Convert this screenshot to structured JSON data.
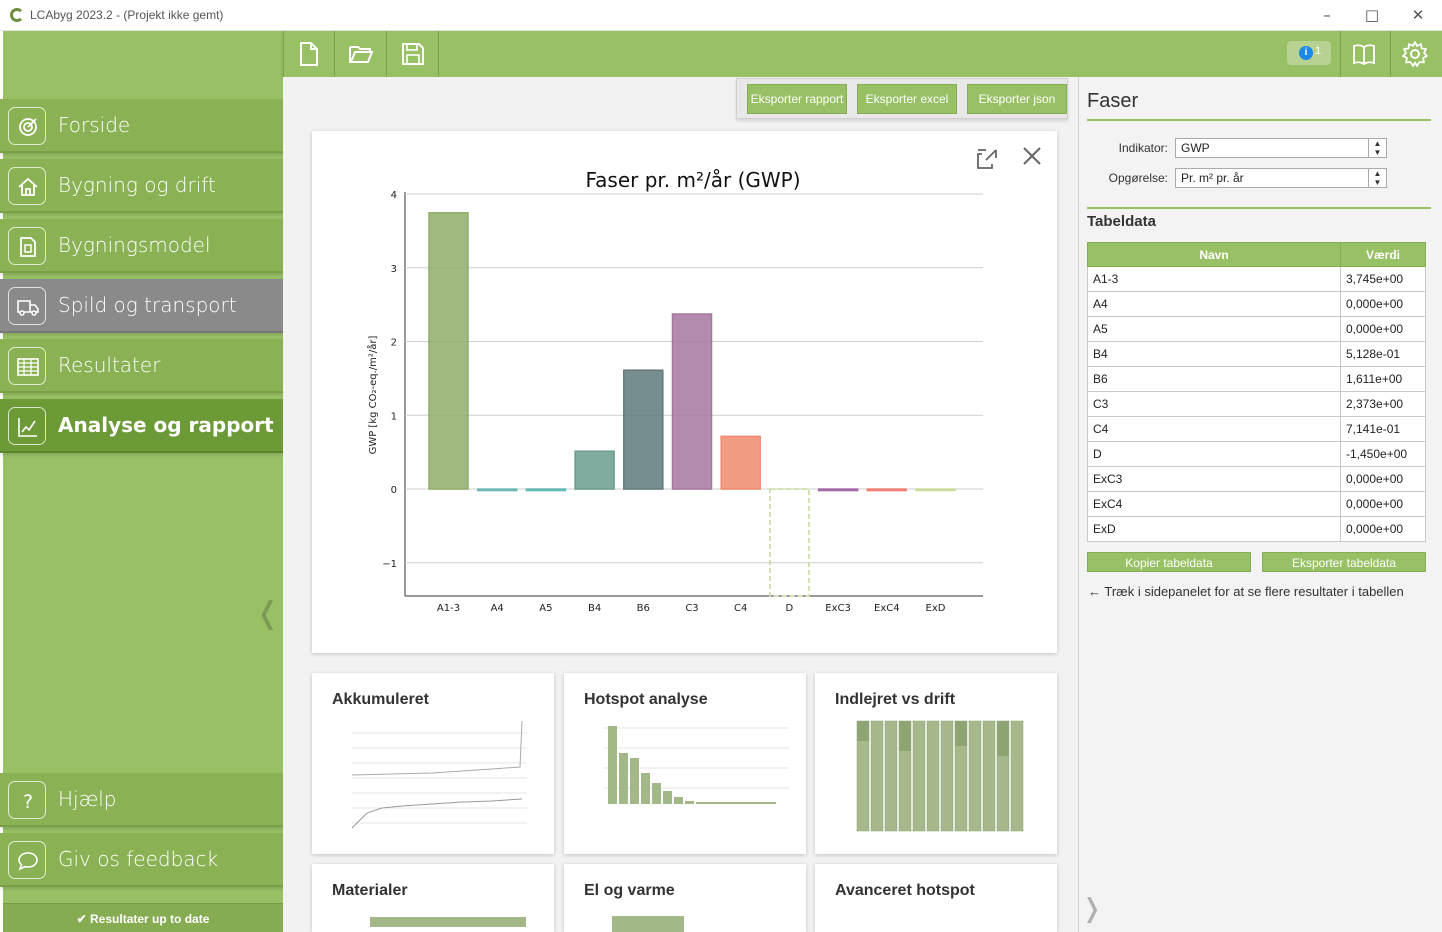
{
  "window": {
    "title": "LCAbyg 2023.2 - (Projekt ikke gemt)",
    "controls": {
      "minimize": "–",
      "maximize": "□",
      "close": "✕"
    }
  },
  "sidebar": {
    "items": [
      {
        "label": "Forside",
        "icon": "home-target-icon",
        "state": "normal"
      },
      {
        "label": "Bygning og drift",
        "icon": "house-icon",
        "state": "normal"
      },
      {
        "label": "Bygningsmodel",
        "icon": "document-icon",
        "state": "normal"
      },
      {
        "label": "Spild og transport",
        "icon": "truck-icon",
        "state": "hover"
      },
      {
        "label": "Resultater",
        "icon": "table-icon",
        "state": "normal"
      },
      {
        "label": "Analyse og rapport",
        "icon": "chart-icon",
        "state": "active"
      }
    ],
    "bottom_items": [
      {
        "label": "Hjælp",
        "icon": "question-icon"
      },
      {
        "label": "Giv os feedback",
        "icon": "speech-bubble-icon"
      }
    ],
    "status": "✔ Resultater up to date",
    "collapse_glyph": "❬"
  },
  "toolbar": {
    "buttons": [
      "new-file-icon",
      "open-folder-icon",
      "save-icon"
    ],
    "notification_count": "1",
    "right_buttons": [
      "book-icon",
      "gear-icon"
    ]
  },
  "export": {
    "report": "Eksporter rapport",
    "excel": "Eksporter excel",
    "json": "Eksporter json"
  },
  "chart_data": {
    "type": "bar",
    "title": "Faser pr. m²/år (GWP)",
    "ylabel": "GWP [kg CO₂-eq./m²/år]",
    "xlabel": "",
    "categories": [
      "A1-3",
      "A4",
      "A5",
      "B4",
      "B6",
      "C3",
      "C4",
      "D",
      "ExC3",
      "ExC4",
      "ExD"
    ],
    "values": [
      3.745,
      0.0,
      0.0,
      0.5128,
      1.611,
      2.373,
      0.7141,
      -1.45,
      0.0,
      0.0,
      0.0
    ],
    "colors": [
      "#8fae68",
      "#6fb7b3",
      "#5fb8b3",
      "#6c9c8e",
      "#5f7a7a",
      "#a577a0",
      "#ef8a6d",
      "#c7dc9e",
      "#a06aa6",
      "#ef7f72",
      "#c9dc9e"
    ],
    "yticks": [
      "4",
      "3",
      "2",
      "1",
      "0",
      "−1"
    ],
    "ylim": [
      -1.45,
      4
    ],
    "grid": true
  },
  "thumbnails": [
    {
      "title": "Akkumuleret"
    },
    {
      "title": "Hotspot analyse"
    },
    {
      "title": "Indlejret vs drift"
    },
    {
      "title": "Materialer"
    },
    {
      "title": "El og varme"
    },
    {
      "title": "Avanceret hotspot"
    }
  ],
  "panel": {
    "title": "Faser",
    "indicator_label": "Indikator:",
    "indicator_value": "GWP",
    "unit_label": "Opgørelse:",
    "unit_value": "Pr. m² pr. år",
    "table_title": "Tabeldata",
    "columns": [
      "Navn",
      "Værdi"
    ],
    "rows": [
      [
        "A1-3",
        "3,745e+00"
      ],
      [
        "A4",
        "0,000e+00"
      ],
      [
        "A5",
        "0,000e+00"
      ],
      [
        "B4",
        "5,128e-01"
      ],
      [
        "B6",
        "1,611e+00"
      ],
      [
        "C3",
        "2,373e+00"
      ],
      [
        "C4",
        "7,141e-01"
      ],
      [
        "D",
        "-1,450e+00"
      ],
      [
        "ExC3",
        "0,000e+00"
      ],
      [
        "ExC4",
        "0,000e+00"
      ],
      [
        "ExD",
        "0,000e+00"
      ]
    ],
    "copy_button": "Kopier tabeldata",
    "export_button": "Eksporter tabeldata",
    "hint": "← Træk i sidepanelet for at se flere resultater i tabellen",
    "collapse_glyph": "❭"
  },
  "colors": {
    "brand_green": "#98c065",
    "active_nav": "#6c9a36",
    "hover_nav": "#8a8a8a"
  }
}
